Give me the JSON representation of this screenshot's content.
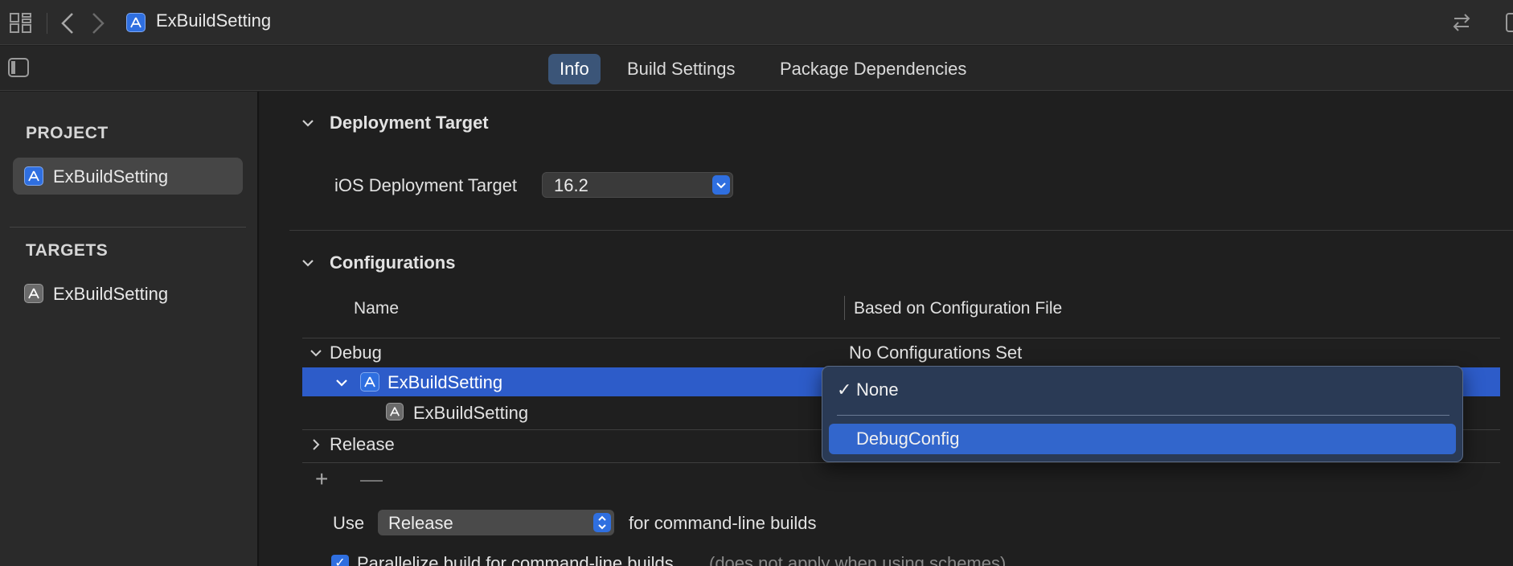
{
  "toolbar": {
    "title": "ExBuildSetting",
    "icons": [
      "grid-icon",
      "back-icon",
      "forward-icon",
      "app-icon",
      "swap-icon",
      "right-panel-icon"
    ]
  },
  "tabs": {
    "items": [
      {
        "label": "Info",
        "active": true
      },
      {
        "label": "Build Settings",
        "active": false
      },
      {
        "label": "Package Dependencies",
        "active": false
      }
    ]
  },
  "sidebar": {
    "project_heading": "PROJECT",
    "project_item": "ExBuildSetting",
    "targets_heading": "TARGETS",
    "target_item": "ExBuildSetting"
  },
  "deployment": {
    "title": "Deployment Target",
    "ios_label": "iOS Deployment Target",
    "ios_value": "16.2"
  },
  "configurations": {
    "title": "Configurations",
    "col_name": "Name",
    "col_based": "Based on Configuration File",
    "rows": [
      {
        "name": "Debug",
        "based": "No Configurations Set"
      },
      {
        "name": "ExBuildSetting",
        "based": ""
      },
      {
        "name": "ExBuildSetting",
        "based": ""
      },
      {
        "name": "Release",
        "based": ""
      }
    ],
    "add_label": "+",
    "remove_label": "—",
    "use_label": "Use",
    "use_value": "Release",
    "use_suffix": "for command-line builds",
    "parallelize_label": "Parallelize build for command-line builds",
    "parallelize_note": "(does not apply when using schemes)",
    "parallelize_checked": true
  },
  "menu": {
    "items": [
      {
        "label": "None",
        "checked": true
      },
      {
        "label": "DebugConfig",
        "checked": false,
        "highlighted": true
      }
    ],
    "check_glyph": "✓"
  },
  "colors": {
    "accent": "#2f6fe0",
    "selection": "#2d5cc9",
    "menu_highlight": "#3266cc"
  }
}
